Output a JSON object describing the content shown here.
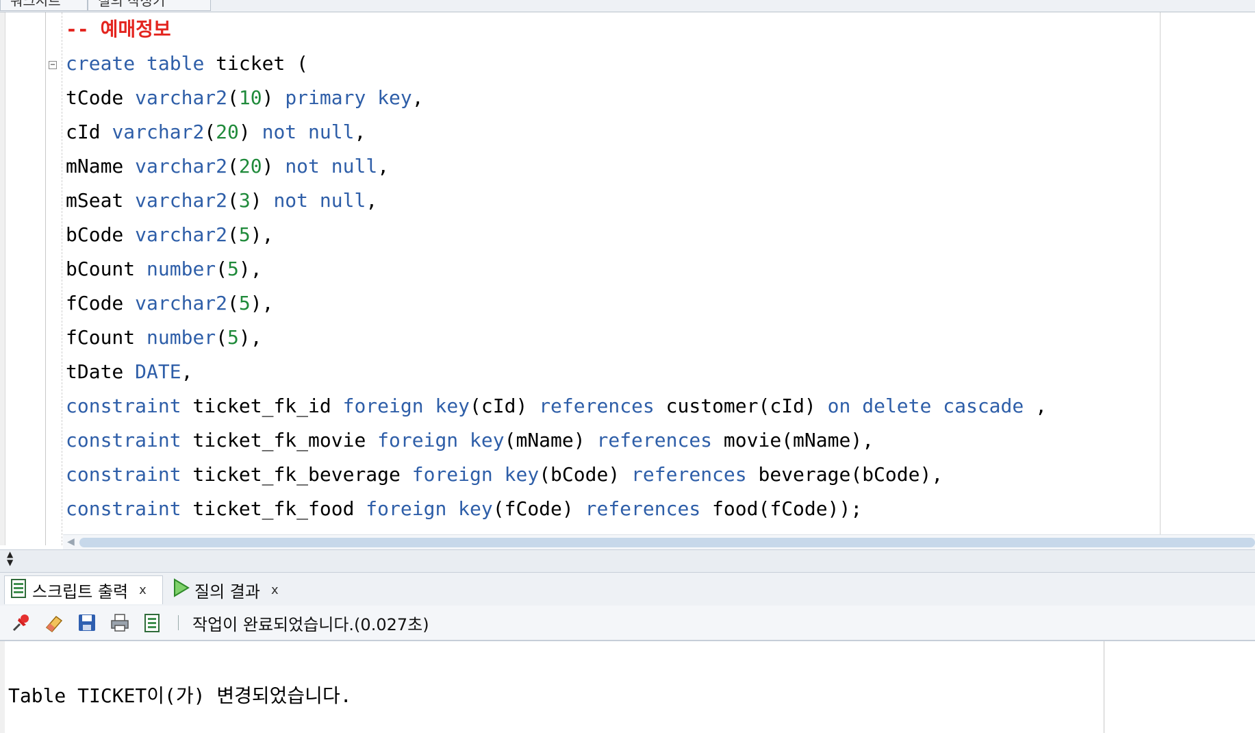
{
  "top_tabs": [
    "워크시트",
    "질의 작성기"
  ],
  "editor": {
    "lines": [
      [
        {
          "t": "-- 예매정보",
          "c": "comment"
        }
      ],
      [
        {
          "t": "create",
          "c": "kw"
        },
        {
          "t": " "
        },
        {
          "t": "table",
          "c": "kw"
        },
        {
          "t": " ticket ("
        }
      ],
      [
        {
          "t": "tCode "
        },
        {
          "t": "varchar2",
          "c": "kw"
        },
        {
          "t": "("
        },
        {
          "t": "10",
          "c": "num"
        },
        {
          "t": ") "
        },
        {
          "t": "primary",
          "c": "kw"
        },
        {
          "t": " "
        },
        {
          "t": "key",
          "c": "kw"
        },
        {
          "t": ","
        }
      ],
      [
        {
          "t": "cId "
        },
        {
          "t": "varchar2",
          "c": "kw"
        },
        {
          "t": "("
        },
        {
          "t": "20",
          "c": "num"
        },
        {
          "t": ") "
        },
        {
          "t": "not",
          "c": "kw"
        },
        {
          "t": " "
        },
        {
          "t": "null",
          "c": "kw"
        },
        {
          "t": ","
        }
      ],
      [
        {
          "t": "mName "
        },
        {
          "t": "varchar2",
          "c": "kw"
        },
        {
          "t": "("
        },
        {
          "t": "20",
          "c": "num"
        },
        {
          "t": ") "
        },
        {
          "t": "not",
          "c": "kw"
        },
        {
          "t": " "
        },
        {
          "t": "null",
          "c": "kw"
        },
        {
          "t": ","
        }
      ],
      [
        {
          "t": "mSeat "
        },
        {
          "t": "varchar2",
          "c": "kw"
        },
        {
          "t": "("
        },
        {
          "t": "3",
          "c": "num"
        },
        {
          "t": ") "
        },
        {
          "t": "not",
          "c": "kw"
        },
        {
          "t": " "
        },
        {
          "t": "null",
          "c": "kw"
        },
        {
          "t": ","
        }
      ],
      [
        {
          "t": "bCode "
        },
        {
          "t": "varchar2",
          "c": "kw"
        },
        {
          "t": "("
        },
        {
          "t": "5",
          "c": "num"
        },
        {
          "t": "),"
        }
      ],
      [
        {
          "t": "bCount "
        },
        {
          "t": "number",
          "c": "kw"
        },
        {
          "t": "("
        },
        {
          "t": "5",
          "c": "num"
        },
        {
          "t": "),"
        }
      ],
      [
        {
          "t": "fCode "
        },
        {
          "t": "varchar2",
          "c": "kw"
        },
        {
          "t": "("
        },
        {
          "t": "5",
          "c": "num"
        },
        {
          "t": "),"
        }
      ],
      [
        {
          "t": "fCount "
        },
        {
          "t": "number",
          "c": "kw"
        },
        {
          "t": "("
        },
        {
          "t": "5",
          "c": "num"
        },
        {
          "t": "),"
        }
      ],
      [
        {
          "t": "tDate "
        },
        {
          "t": "DATE",
          "c": "kw"
        },
        {
          "t": ","
        }
      ],
      [
        {
          "t": "constraint",
          "c": "kw"
        },
        {
          "t": " ticket_fk_id "
        },
        {
          "t": "foreign",
          "c": "kw"
        },
        {
          "t": " "
        },
        {
          "t": "key",
          "c": "kw"
        },
        {
          "t": "(cId) "
        },
        {
          "t": "references",
          "c": "kw"
        },
        {
          "t": " customer(cId) "
        },
        {
          "t": "on",
          "c": "kw"
        },
        {
          "t": " "
        },
        {
          "t": "delete",
          "c": "kw"
        },
        {
          "t": " "
        },
        {
          "t": "cascade",
          "c": "kw"
        },
        {
          "t": " ,"
        }
      ],
      [
        {
          "t": "constraint",
          "c": "kw"
        },
        {
          "t": " ticket_fk_movie "
        },
        {
          "t": "foreign",
          "c": "kw"
        },
        {
          "t": " "
        },
        {
          "t": "key",
          "c": "kw"
        },
        {
          "t": "(mName) "
        },
        {
          "t": "references",
          "c": "kw"
        },
        {
          "t": " movie(mName),"
        }
      ],
      [
        {
          "t": "constraint",
          "c": "kw"
        },
        {
          "t": " ticket_fk_beverage "
        },
        {
          "t": "foreign",
          "c": "kw"
        },
        {
          "t": " "
        },
        {
          "t": "key",
          "c": "kw"
        },
        {
          "t": "(bCode) "
        },
        {
          "t": "references",
          "c": "kw"
        },
        {
          "t": " beverage(bCode),"
        }
      ],
      [
        {
          "t": "constraint",
          "c": "kw"
        },
        {
          "t": " ticket_fk_food "
        },
        {
          "t": "foreign",
          "c": "kw"
        },
        {
          "t": " "
        },
        {
          "t": "key",
          "c": "kw"
        },
        {
          "t": "(fCode) "
        },
        {
          "t": "references",
          "c": "kw"
        },
        {
          "t": " food(fCode));"
        }
      ]
    ],
    "colors": {
      "keyword": "#2e5ea8",
      "number": "#1f8a3a",
      "comment": "#e3251f"
    }
  },
  "panel": {
    "tabs": [
      {
        "label": "스크립트 출력",
        "icon": "script-output-icon",
        "close": "x"
      },
      {
        "label": "질의 결과",
        "icon": "run-query-icon",
        "close": "x"
      }
    ],
    "toolbar": {
      "icons": [
        "pin-icon",
        "eraser-icon",
        "save-icon",
        "print-icon",
        "document-icon"
      ],
      "status": "작업이 완료되었습니다.(0.027초)"
    },
    "output": "Table TICKET이(가) 변경되었습니다."
  }
}
